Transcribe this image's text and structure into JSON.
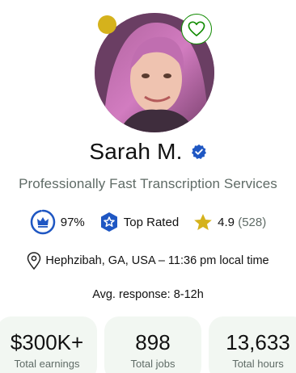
{
  "profile": {
    "name": "Sarah M.",
    "tagline": "Professionally Fast Transcription Services",
    "location": "Hephzibah, GA, USA – 11:36 pm local time",
    "response": "Avg. response: 8-12h"
  },
  "badges": {
    "job_success": "97%",
    "job_success_fraction": 0.97,
    "top_rated": "Top Rated",
    "rating": "4.9",
    "rating_count": "(528)"
  },
  "cards": [
    {
      "value": "$300K+",
      "label": "Total earnings"
    },
    {
      "value": "898",
      "label": "Total jobs"
    },
    {
      "value": "13,633",
      "label": "Total hours"
    }
  ],
  "colors": {
    "brand_green": "#108a00",
    "status_dot": "#d5b21c",
    "verified_blue": "#1f57c3",
    "star": "#d5b21c"
  },
  "icons": {
    "favorite": "heart-icon",
    "verified": "verified-check-icon",
    "top_rated": "star-badge-icon",
    "location": "location-pin-icon",
    "job_success": "crown-icon"
  }
}
